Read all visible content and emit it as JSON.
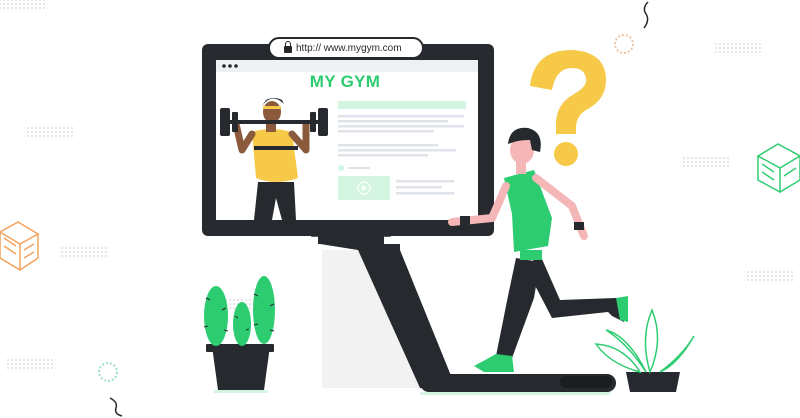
{
  "browser": {
    "url": "http:// www.mygym.com"
  },
  "website": {
    "title": "MY GYM"
  },
  "colors": {
    "accent_green": "#2ecc71",
    "question_yellow": "#f7c948",
    "dark": "#262a2e",
    "decor_orange": "#f2a25c"
  },
  "icons": [
    "lock-icon",
    "play-icon",
    "question-mark-icon",
    "cactus-icon",
    "plant-icon",
    "dumbbell-icon"
  ]
}
